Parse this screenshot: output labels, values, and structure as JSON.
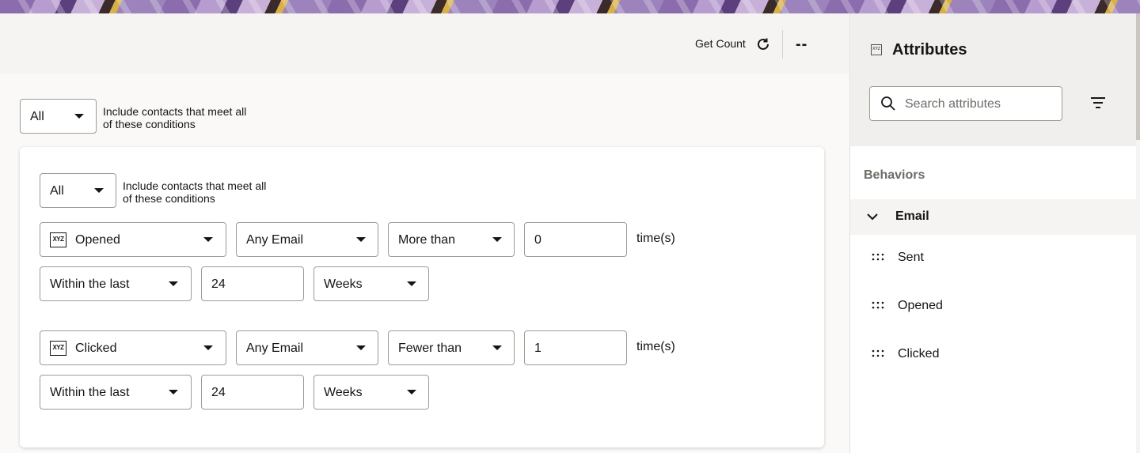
{
  "header": {
    "get_count_label": "Get Count",
    "count_value": "--"
  },
  "outer_group": {
    "match_select": "All",
    "helper": "Include contacts that meet all of these conditions"
  },
  "inner_group": {
    "match_select": "All",
    "helper": "Include contacts that meet all of these conditions",
    "conditions": [
      {
        "attribute": "Opened",
        "email": "Any Email",
        "operator": "More than",
        "count": "0",
        "unit_label": "time(s)",
        "timeframe": "Within the last",
        "period_value": "24",
        "period_unit": "Weeks"
      },
      {
        "attribute": "Clicked",
        "email": "Any Email",
        "operator": "Fewer than",
        "count": "1",
        "unit_label": "time(s)",
        "timeframe": "Within the last",
        "period_value": "24",
        "period_unit": "Weeks"
      }
    ]
  },
  "sidebar": {
    "title": "Attributes",
    "search_placeholder": "Search attributes",
    "section": "Behaviors",
    "group": "Email",
    "items": [
      "Sent",
      "Opened",
      "Clicked"
    ]
  },
  "icons": {
    "attribute_type": "xyz-icon",
    "refresh": "refresh-icon",
    "search": "search-icon",
    "filter": "filter-icon",
    "chevron": "chevron-down-icon",
    "drag": "drag-handle-icon"
  },
  "colors": {
    "text": "#161513",
    "border": "#9e9a96",
    "muted": "#6f6b67",
    "panel_bg": "#f1efed"
  }
}
